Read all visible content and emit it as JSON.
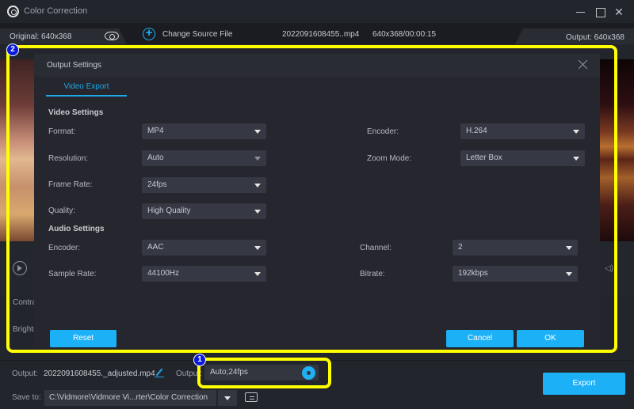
{
  "window": {
    "title": "Color Correction",
    "icon": "color-wheel-icon"
  },
  "header": {
    "original_label": "Original: 640x368",
    "change_source_label": "Change Source File",
    "file_name": "2022091608455..mp4",
    "file_meta": "640x368/00:00:15",
    "output_label": "Output: 640x368"
  },
  "side": {
    "contrast_label": "Contra",
    "brightness_label": "Brightn"
  },
  "dialog": {
    "title": "Output Settings",
    "tab": "Video Export",
    "video_section": "Video Settings",
    "audio_section": "Audio Settings",
    "video_fields": {
      "format": {
        "label": "Format:",
        "value": "MP4"
      },
      "resolution": {
        "label": "Resolution:",
        "value": "Auto"
      },
      "frame_rate": {
        "label": "Frame Rate:",
        "value": "24fps"
      },
      "quality": {
        "label": "Quality:",
        "value": "High Quality"
      },
      "encoder": {
        "label": "Encoder:",
        "value": "H.264"
      },
      "zoom_mode": {
        "label": "Zoom Mode:",
        "value": "Letter Box"
      }
    },
    "audio_fields": {
      "encoder": {
        "label": "Encoder:",
        "value": "AAC"
      },
      "sample_rate": {
        "label": "Sample Rate:",
        "value": "44100Hz"
      },
      "channel": {
        "label": "Channel:",
        "value": "2"
      },
      "bitrate": {
        "label": "Bitrate:",
        "value": "192kbps"
      }
    },
    "buttons": {
      "reset": "Reset",
      "cancel": "Cancel",
      "ok": "OK"
    }
  },
  "annotations": {
    "one": "1",
    "two": "2",
    "color": "#ffff00"
  },
  "bottom": {
    "output_label": "Output:",
    "output_file": "2022091608455._adjusted.mp4",
    "output_settings_label": "Output:",
    "output_settings_value": "Auto;24fps",
    "save_to_label": "Save to:",
    "save_path": "C:\\Vidmore\\Vidmore Vi...rter\\Color Correction",
    "export_label": "Export"
  },
  "colors": {
    "accent": "#1cb1f6",
    "background": "#23252d",
    "dialog": "#25262e"
  }
}
